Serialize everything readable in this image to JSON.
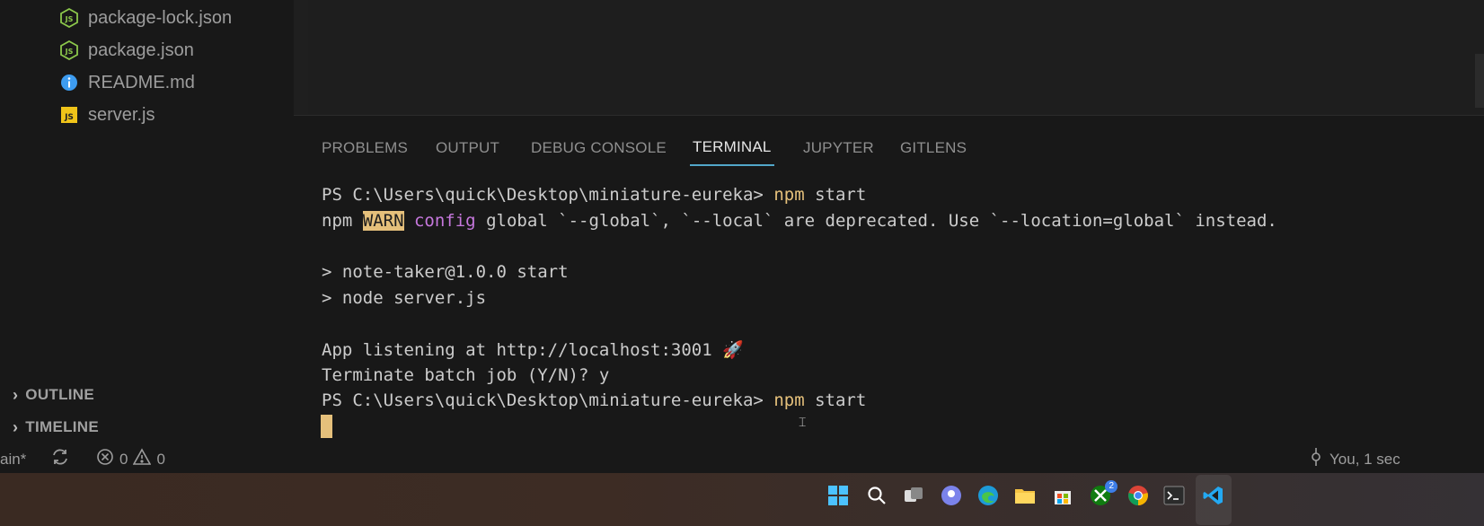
{
  "explorer": {
    "files": [
      {
        "name": "package-lock.json",
        "icon": "nodejs-icon"
      },
      {
        "name": "package.json",
        "icon": "nodejs-icon"
      },
      {
        "name": "README.md",
        "icon": "info-icon"
      },
      {
        "name": "server.js",
        "icon": "js-icon"
      }
    ],
    "sections": [
      {
        "label": "OUTLINE"
      },
      {
        "label": "TIMELINE"
      }
    ]
  },
  "panel": {
    "tabs": [
      {
        "label": "PROBLEMS",
        "active": false
      },
      {
        "label": "OUTPUT",
        "active": false
      },
      {
        "label": "DEBUG CONSOLE",
        "active": false
      },
      {
        "label": "TERMINAL",
        "active": true
      },
      {
        "label": "JUPYTER",
        "active": false
      },
      {
        "label": "GITLENS",
        "active": false
      }
    ]
  },
  "terminal": {
    "prompt1": "PS C:\\Users\\quick\\Desktop\\miniature-eureka> ",
    "cmd1_npm": "npm",
    "cmd1_rest": " start",
    "warn_npm": "npm ",
    "warn_tag": "WARN",
    "warn_config": "config",
    "warn_msg": " global `--global`, `--local` are deprecated. Use `--location=global` instead.",
    "script1": "> note-taker@1.0.0 start",
    "script2": "> node server.js",
    "listening": "App listening at http://localhost:3001 🚀",
    "terminate": "Terminate batch job (Y/N)? y",
    "prompt2": "PS C:\\Users\\quick\\Desktop\\miniature-eureka> ",
    "cmd2_npm": "npm",
    "cmd2_rest": " start"
  },
  "statusbar": {
    "branch": "ain*",
    "errors": "0",
    "warnings": "0",
    "blame": "You, 1 sec"
  },
  "taskbar": {
    "badge_count": "2"
  },
  "colors": {
    "accent": "#52a7c9",
    "terminal_yellow": "#e5c07b",
    "terminal_purple": "#c678dd"
  }
}
